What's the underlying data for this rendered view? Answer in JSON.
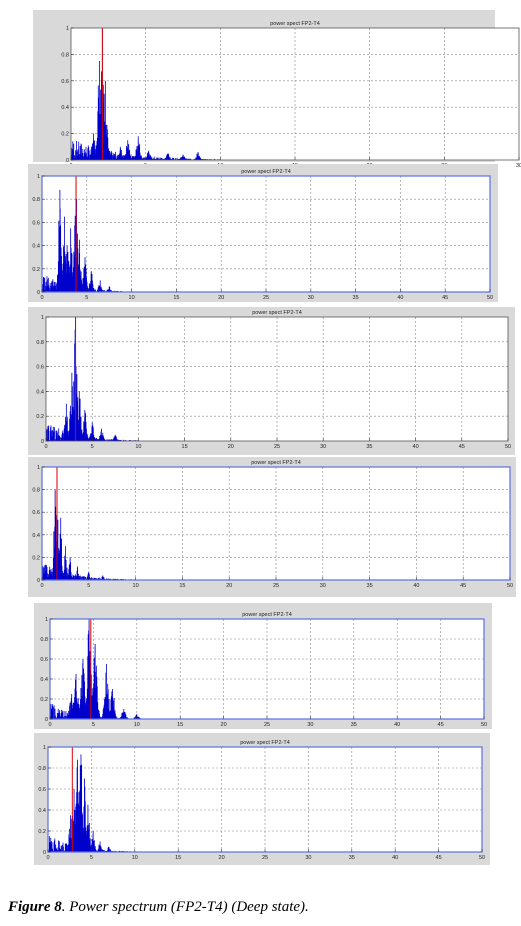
{
  "caption": {
    "label": "Figure 8",
    "text": ". Power spectrum (FP2-T4) (Deep state)."
  },
  "colors": {
    "trace": "#0000cc",
    "marker": "#e00000",
    "frame_blue": "#5b6fe6",
    "panel_bg": "#d9d9d9"
  },
  "chart_data": [
    {
      "type": "line",
      "title": "power spect FP2-T4",
      "xlim": [
        0,
        30
      ],
      "ylim": [
        0,
        1
      ],
      "xticks": [
        "0",
        "5",
        "10",
        "15",
        "20",
        "25",
        "30"
      ],
      "yticks": [
        "0",
        "0.2",
        "0.4",
        "0.6",
        "0.8",
        "1"
      ],
      "grid": true,
      "marker_x": 2.1,
      "series": [
        {
          "peaks": [
            [
              2.1,
              1.0
            ],
            [
              1.9,
              0.75
            ],
            [
              2.3,
              0.6
            ],
            [
              1.5,
              0.2
            ],
            [
              3.3,
              0.1
            ],
            [
              3.8,
              0.15
            ],
            [
              4.5,
              0.18
            ],
            [
              5.2,
              0.07
            ],
            [
              6.5,
              0.05
            ],
            [
              7.5,
              0.04
            ],
            [
              8.5,
              0.06
            ]
          ],
          "spread": 0.5,
          "max_x": 10
        }
      ]
    },
    {
      "type": "line",
      "title": "power spect FP2-T4",
      "xlim": [
        0,
        50
      ],
      "ylim": [
        0,
        1
      ],
      "xticks": [
        "0",
        "5",
        "10",
        "15",
        "20",
        "25",
        "30",
        "35",
        "40",
        "45",
        "50"
      ],
      "yticks": [
        "0",
        "0.2",
        "0.4",
        "0.6",
        "0.8",
        "1"
      ],
      "grid": true,
      "marker_x": 3.8,
      "series": [
        {
          "peaks": [
            [
              2.0,
              0.88
            ],
            [
              2.5,
              0.65
            ],
            [
              3.8,
              1.0
            ],
            [
              3.2,
              0.55
            ],
            [
              4.2,
              0.45
            ],
            [
              4.8,
              0.3
            ],
            [
              2.8,
              0.4
            ],
            [
              5.5,
              0.18
            ],
            [
              6.5,
              0.1
            ],
            [
              7.5,
              0.05
            ]
          ],
          "spread": 0.7,
          "max_x": 9
        }
      ]
    },
    {
      "type": "line",
      "title": "power spect FP2-T4",
      "xlim": [
        0,
        50
      ],
      "ylim": [
        0,
        1
      ],
      "xticks": [
        "0",
        "5",
        "10",
        "15",
        "20",
        "25",
        "30",
        "35",
        "40",
        "45",
        "50"
      ],
      "yticks": [
        "0",
        "0.2",
        "0.4",
        "0.6",
        "0.8",
        "1"
      ],
      "grid": true,
      "marker_x": 3.2,
      "series": [
        {
          "peaks": [
            [
              3.2,
              1.0
            ],
            [
              2.8,
              0.55
            ],
            [
              3.6,
              0.4
            ],
            [
              2.2,
              0.3
            ],
            [
              4.2,
              0.25
            ],
            [
              5.0,
              0.15
            ],
            [
              6.0,
              0.1
            ],
            [
              7.5,
              0.05
            ]
          ],
          "spread": 0.7,
          "max_x": 10
        }
      ]
    },
    {
      "type": "line",
      "title": "power spect FP2-T4",
      "xlim": [
        0,
        50
      ],
      "ylim": [
        0,
        1
      ],
      "xticks": [
        "0",
        "5",
        "10",
        "15",
        "20",
        "25",
        "30",
        "35",
        "40",
        "45",
        "50"
      ],
      "yticks": [
        "0",
        "0.2",
        "0.4",
        "0.6",
        "0.8",
        "1"
      ],
      "grid": true,
      "marker_x": 1.6,
      "series": [
        {
          "peaks": [
            [
              1.6,
              1.0
            ],
            [
              1.4,
              0.8
            ],
            [
              2.0,
              0.55
            ],
            [
              2.5,
              0.3
            ],
            [
              3.0,
              0.2
            ],
            [
              3.8,
              0.12
            ],
            [
              5.0,
              0.07
            ],
            [
              6.5,
              0.04
            ]
          ],
          "spread": 0.5,
          "max_x": 10
        }
      ]
    },
    {
      "type": "line",
      "title": "power spect FP2-T4",
      "xlim": [
        0,
        50
      ],
      "ylim": [
        0,
        1
      ],
      "xticks": [
        "0",
        "5",
        "10",
        "15",
        "20",
        "25",
        "30",
        "35",
        "40",
        "45",
        "50"
      ],
      "yticks": [
        "0",
        "0.2",
        "0.4",
        "0.6",
        "0.8",
        "1"
      ],
      "grid": true,
      "marker_x": 4.7,
      "series": [
        {
          "peaks": [
            [
              4.5,
              1.0
            ],
            [
              3.8,
              0.6
            ],
            [
              5.2,
              0.75
            ],
            [
              3.0,
              0.45
            ],
            [
              6.5,
              0.55
            ],
            [
              7.2,
              0.3
            ],
            [
              2.5,
              0.25
            ],
            [
              8.5,
              0.1
            ],
            [
              10.0,
              0.05
            ]
          ],
          "spread": 0.9,
          "max_x": 12
        }
      ]
    },
    {
      "type": "line",
      "title": "power spect FP2-T4",
      "xlim": [
        0,
        50
      ],
      "ylim": [
        0,
        1
      ],
      "xticks": [
        "0",
        "5",
        "10",
        "15",
        "20",
        "25",
        "30",
        "35",
        "40",
        "45",
        "50"
      ],
      "yticks": [
        "0",
        "0.2",
        "0.4",
        "0.6",
        "0.8",
        "1"
      ],
      "grid": true,
      "marker_x": 2.8,
      "series": [
        {
          "peaks": [
            [
              3.8,
              0.93
            ],
            [
              3.4,
              0.88
            ],
            [
              3.0,
              0.6
            ],
            [
              4.2,
              0.7
            ],
            [
              4.6,
              0.45
            ],
            [
              2.6,
              0.35
            ],
            [
              5.2,
              0.2
            ],
            [
              6.0,
              0.1
            ],
            [
              7.0,
              0.05
            ]
          ],
          "spread": 0.7,
          "max_x": 10
        }
      ]
    }
  ]
}
